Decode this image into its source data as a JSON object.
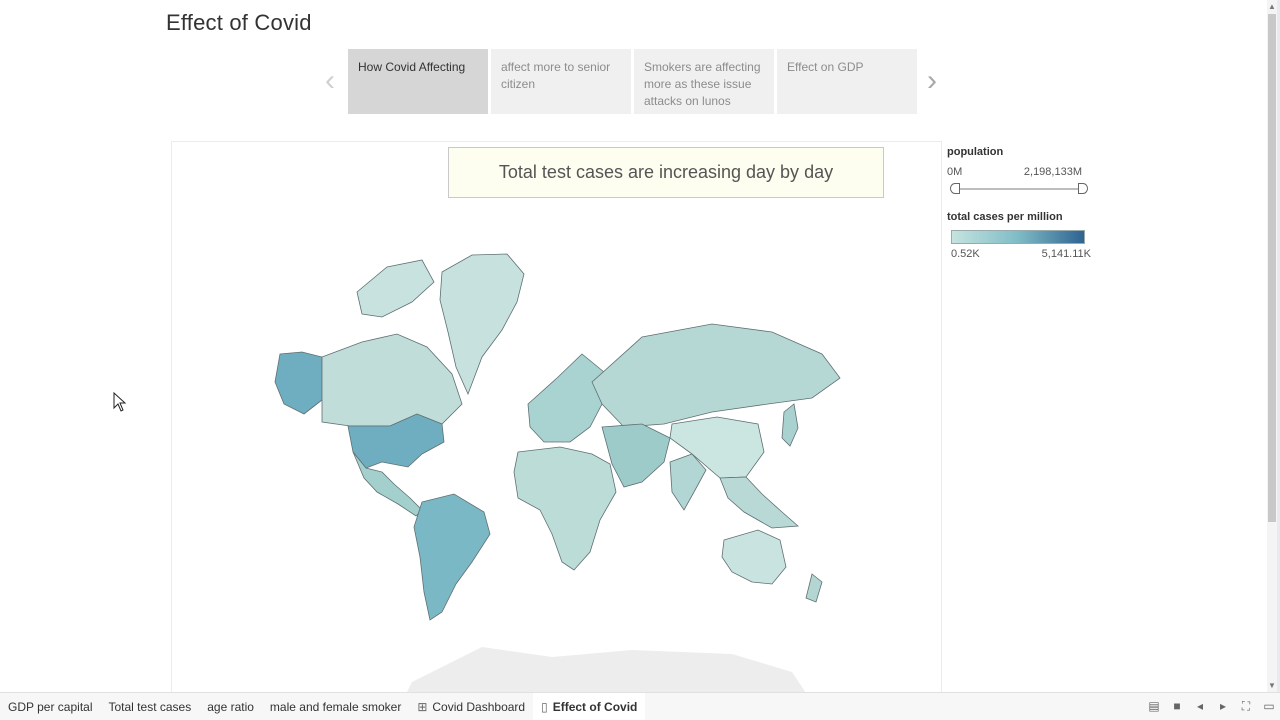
{
  "story": {
    "title": "Effect of Covid",
    "points": [
      "How Covid Affecting",
      "affect more to senior citizen",
      "Smokers are affecting more as these issue attacks on lunos",
      "Effect on GDP"
    ],
    "active_index": 0
  },
  "annotation": "Total test cases are increasing day by day",
  "legend_population": {
    "title": "population",
    "min_label": "0M",
    "max_label": "2,198,133M"
  },
  "legend_cases": {
    "title": "total cases per million",
    "min_label": "0.52K",
    "max_label": "5,141.11K",
    "color_low": "#c6e3df",
    "color_mid": "#7fbcc6",
    "color_high": "#2f6391"
  },
  "tabs": [
    {
      "label": "GDP per capital",
      "icon": ""
    },
    {
      "label": "Total test cases",
      "icon": ""
    },
    {
      "label": "age ratio",
      "icon": ""
    },
    {
      "label": "male and female smoker",
      "icon": ""
    },
    {
      "label": "Covid Dashboard",
      "icon": "grid-icon"
    },
    {
      "label": "Effect of Covid",
      "icon": "story-icon"
    }
  ],
  "active_tab": 5
}
